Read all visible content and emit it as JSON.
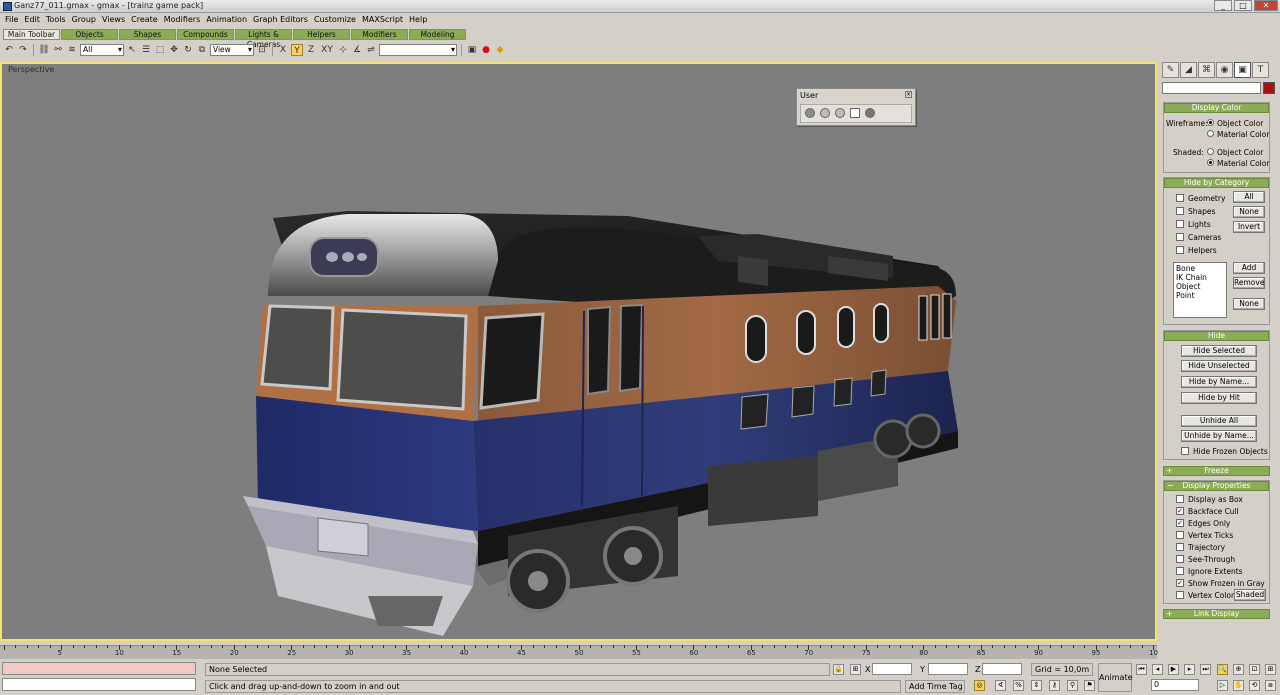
{
  "window": {
    "title": "Ganz77_011.gmax - gmax - [trainz game pack]"
  },
  "menu": [
    "File",
    "Edit",
    "Tools",
    "Group",
    "Views",
    "Create",
    "Modifiers",
    "Animation",
    "Graph Editors",
    "Customize",
    "MAXScript",
    "Help"
  ],
  "tabs": [
    "Main Toolbar",
    "Objects",
    "Shapes",
    "Compounds",
    "Lights & Cameras",
    "Helpers",
    "Modifiers",
    "Modeling"
  ],
  "toolbar": {
    "filter_value": "All",
    "refcoord_value": "View",
    "axis_x": "X",
    "axis_y": "Y",
    "axis_z": "Z",
    "axis_xy": "XY",
    "selection_set_value": ""
  },
  "viewport": {
    "label": "Perspective"
  },
  "user_panel": {
    "title": "User"
  },
  "command_panel": {
    "display_color": {
      "title": "Display Color",
      "wireframe_label": "Wireframe:",
      "shaded_label": "Shaded:",
      "object_color": "Object Color",
      "material_color": "Material Color"
    },
    "hide_by_category": {
      "title": "Hide by Category",
      "items": [
        "Geometry",
        "Shapes",
        "Lights",
        "Cameras",
        "Helpers"
      ],
      "btn_all": "All",
      "btn_none": "None",
      "btn_invert": "Invert",
      "list": [
        "Bone",
        "IK Chain Object",
        "Point"
      ],
      "btn_add": "Add",
      "btn_remove": "Remove",
      "btn_none2": "None"
    },
    "hide": {
      "title": "Hide",
      "buttons": [
        "Hide Selected",
        "Hide Unselected",
        "Hide by Name...",
        "Hide by Hit"
      ],
      "unhide": [
        "Unhide All",
        "Unhide by Name..."
      ],
      "frozen": "Hide Frozen Objects"
    },
    "freeze": {
      "title": "Freeze"
    },
    "display_properties": {
      "title": "Display Properties",
      "items": [
        {
          "label": "Display as Box",
          "checked": false
        },
        {
          "label": "Backface Cull",
          "checked": true
        },
        {
          "label": "Edges Only",
          "checked": true
        },
        {
          "label": "Vertex Ticks",
          "checked": false
        },
        {
          "label": "Trajectory",
          "checked": false
        },
        {
          "label": "See-Through",
          "checked": false
        },
        {
          "label": "Ignore Extents",
          "checked": false
        },
        {
          "label": "Show Frozen in Gray",
          "checked": true
        },
        {
          "label": "Vertex Colors",
          "checked": false
        }
      ],
      "shaded_btn": "Shaded"
    },
    "link_display": {
      "title": "Link Display"
    }
  },
  "timeline": {
    "ticks": [
      "5",
      "10",
      "15",
      "20",
      "25",
      "30",
      "35",
      "40",
      "45",
      "50",
      "55",
      "60",
      "65",
      "70",
      "75",
      "80",
      "85",
      "90",
      "95",
      "100"
    ]
  },
  "status": {
    "selection": "None Selected",
    "prompt": "Click and drag up-and-down to zoom in and out",
    "x_label": "X",
    "y_label": "Y",
    "z_label": "Z",
    "grid": "Grid = 10,0m",
    "add_time_tag": "Add Time Tag",
    "animate": "Animate",
    "frame": "0"
  }
}
